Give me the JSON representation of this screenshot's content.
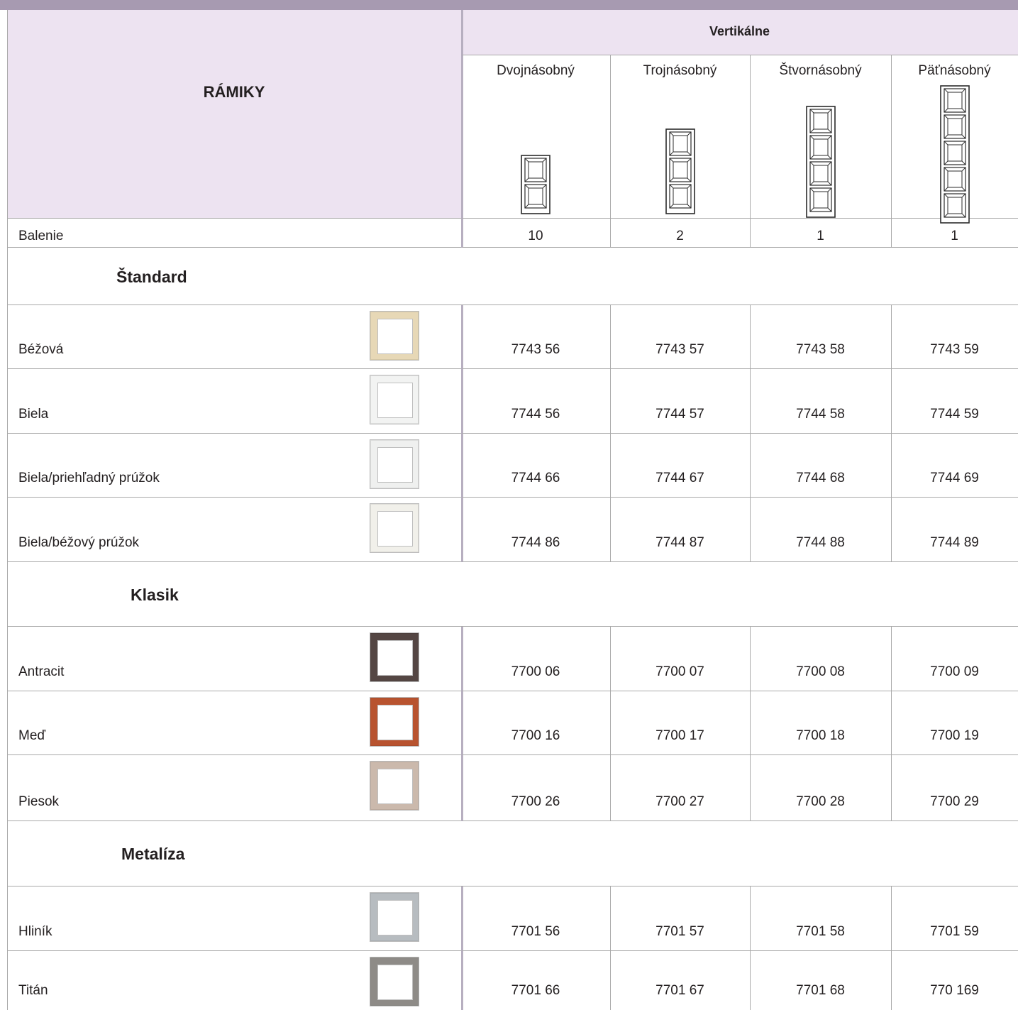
{
  "header": {
    "title": "RÁMIKY",
    "group_label": "Vertikálne",
    "columns": [
      "Dvojnásobný",
      "Trojnásobný",
      "Štvornásobný",
      "Päťnásobný"
    ],
    "column_gang_counts": [
      2,
      3,
      4,
      5
    ]
  },
  "packaging": {
    "label": "Balenie",
    "values": [
      "10",
      "2",
      "1",
      "1"
    ]
  },
  "sections": [
    {
      "title": "Štandard",
      "rows": [
        {
          "name": "Béžová",
          "swatch": "#e7d8b6",
          "codes": [
            "7743 56",
            "7743 57",
            "7743 58",
            "7743 59"
          ]
        },
        {
          "name": "Biela",
          "swatch": "#f2f3f2",
          "codes": [
            "7744 56",
            "7744 57",
            "7744 58",
            "7744 59"
          ]
        },
        {
          "name": "Biela/priehľadný prúžok",
          "swatch": "#eff0ef",
          "codes": [
            "7744 66",
            "7744 67",
            "7744 68",
            "7744 69"
          ]
        },
        {
          "name": "Biela/béžový prúžok",
          "swatch": "#f1f0ea",
          "codes": [
            "7744 86",
            "7744 87",
            "7744 88",
            "7744 89"
          ]
        }
      ]
    },
    {
      "title": "Klasik",
      "rows": [
        {
          "name": "Antracit",
          "swatch": "#544643",
          "codes": [
            "7700 06",
            "7700 07",
            "7700 08",
            "7700 09"
          ]
        },
        {
          "name": "Meď",
          "swatch": "#b8532f",
          "codes": [
            "7700 16",
            "7700 17",
            "7700 18",
            "7700 19"
          ]
        },
        {
          "name": "Piesok",
          "swatch": "#cbb9ac",
          "codes": [
            "7700 26",
            "7700 27",
            "7700 28",
            "7700 29"
          ]
        }
      ]
    },
    {
      "title": "Metalíza",
      "rows": [
        {
          "name": "Hliník",
          "swatch": "#b7bcc0",
          "codes": [
            "7701 56",
            "7701 57",
            "7701 58",
            "7701 59"
          ]
        },
        {
          "name": "Titán",
          "swatch": "#8e8b87",
          "codes": [
            "7701 66",
            "7701 67",
            "7701 68",
            "770 169"
          ]
        }
      ]
    }
  ],
  "colors": {
    "header_bg": "#ede3f1",
    "top_bar": "#a79ab1",
    "grid_line": "#a9a9a9"
  }
}
